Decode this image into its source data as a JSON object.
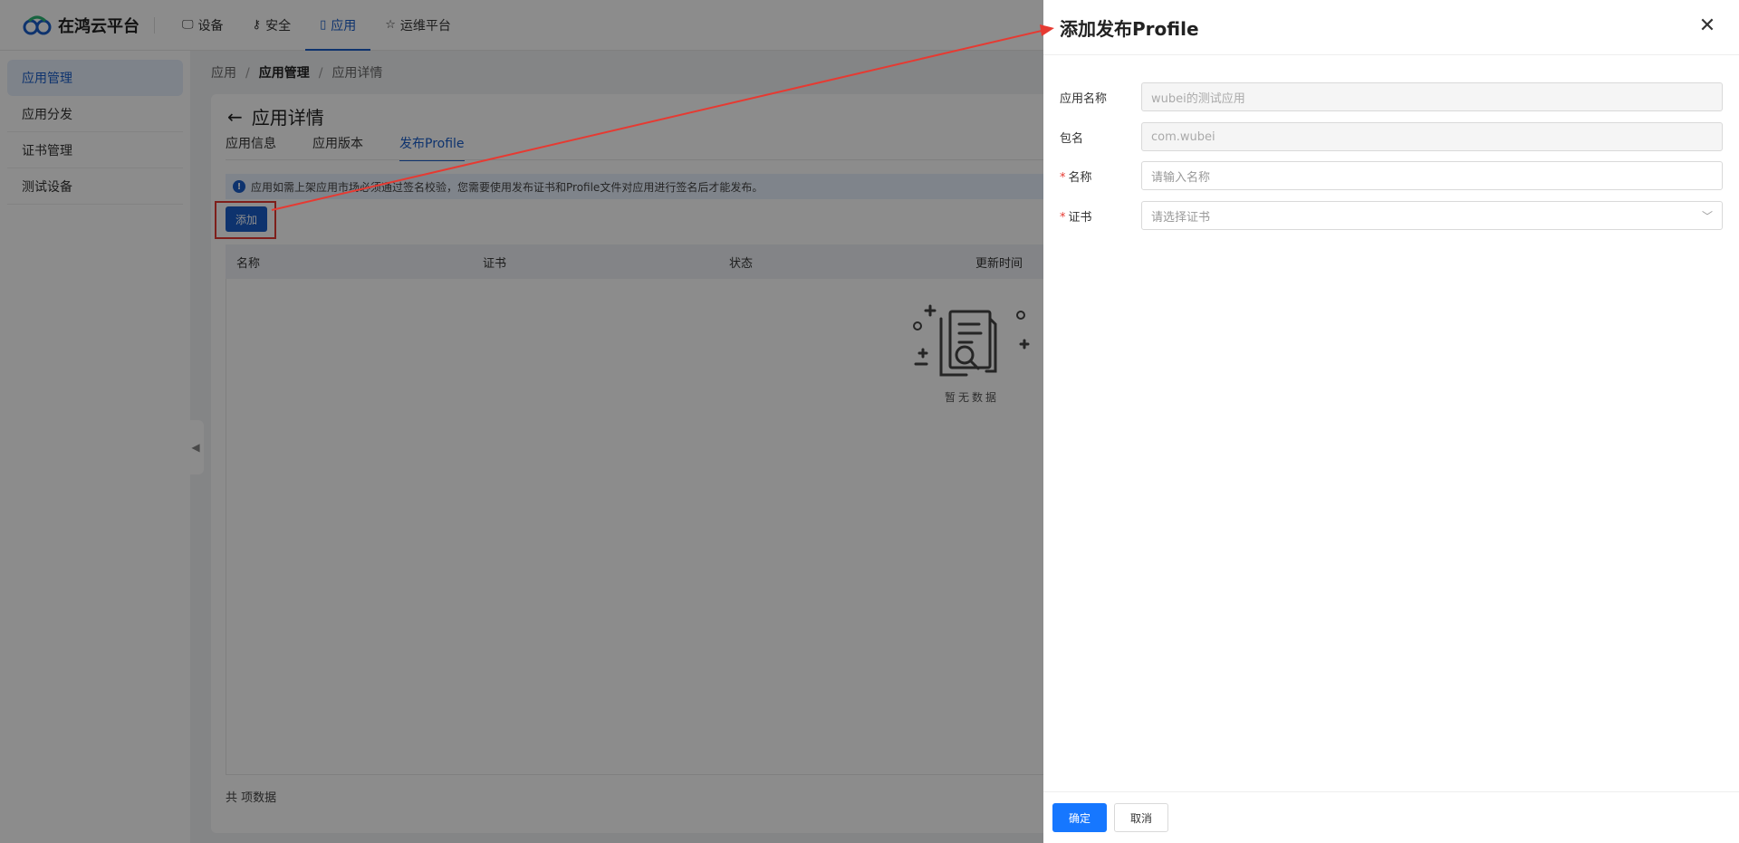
{
  "brand": {
    "name": "在鸿云平台"
  },
  "nav": [
    {
      "icon": "monitor-icon",
      "glyph": "🖵",
      "label": "设备"
    },
    {
      "icon": "key-icon",
      "glyph": "⚷",
      "label": "安全"
    },
    {
      "icon": "tablet-icon",
      "glyph": "▯",
      "label": "应用"
    },
    {
      "icon": "star-icon",
      "glyph": "☆",
      "label": "运维平台"
    }
  ],
  "sidebar": {
    "items": [
      "应用管理",
      "应用分发",
      "证书管理",
      "测试设备"
    ]
  },
  "breadcrumb": [
    "应用",
    "应用管理",
    "应用详情"
  ],
  "page": {
    "title": "应用详情",
    "tabs": [
      "应用信息",
      "应用版本",
      "发布Profile"
    ],
    "alert": "应用如需上架应用市场必须通过签名校验，您需要使用发布证书和Profile文件对应用进行签名后才能发布。",
    "add_label": "添加",
    "table_columns": [
      "名称",
      "证书",
      "状态",
      "更新时间"
    ],
    "empty_text": "暂无数据",
    "total_text": "共 项数据"
  },
  "drawer": {
    "title": "添加发布Profile",
    "fields": [
      {
        "label": "应用名称",
        "value": "wubei的测试应用",
        "required": false
      },
      {
        "label": "包名",
        "value": "com.wubei",
        "required": false
      },
      {
        "label": "名称",
        "placeholder": "请输入名称",
        "required": true
      },
      {
        "label": "证书",
        "placeholder": "请选择证书",
        "required": true
      }
    ],
    "confirm_label": "确定",
    "cancel_label": "取消"
  },
  "colors": {
    "accent": "#1a5ec9",
    "primary_button": "#1677ff",
    "annotation": "#e63a32"
  }
}
